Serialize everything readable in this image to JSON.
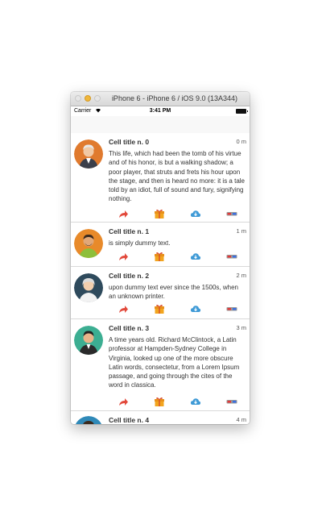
{
  "window": {
    "title": "iPhone 6 - iPhone 6 / iOS 9.0 (13A344)"
  },
  "status_bar": {
    "carrier": "Carrier",
    "time": "3:41 PM"
  },
  "colors": {
    "share": "#e2493b",
    "gift": "#f2a51f",
    "cloud": "#3f9ad6",
    "glasses_left": "#e23a3a",
    "glasses_right": "#3a6fe2"
  },
  "cells": [
    {
      "title": "Cell title n. 0",
      "time": "0 m",
      "body": "This life, which had been the tomb of his virtue and of his honor, is but a walking shadow; a poor player, that struts and frets his hour upon the stage, and then is heard no more: it is a tale told by an idiot, full of sound and fury, signifying nothing.",
      "avatar_bg": "#e07a2e"
    },
    {
      "title": "Cell title n. 1",
      "time": "1 m",
      "body": "is simply dummy text.",
      "avatar_bg": "#e88a2a"
    },
    {
      "title": "Cell title n. 2",
      "time": "2 m",
      "body": "upon dummy text ever since the 1500s, when an unknown printer.",
      "avatar_bg": "#2e4a5c"
    },
    {
      "title": "Cell title n. 3",
      "time": "3 m",
      "body": "A time  years old. Richard McClintock, a Latin professor at Hampden-Sydney College in Virginia, looked up one of the more obscure Latin words, consectetur, from a Lorem Ipsum passage, and going through the cites of the word in classica.",
      "avatar_bg": "#3cae92"
    },
    {
      "title": "Cell title n. 4",
      "time": "4 m",
      "body": "",
      "avatar_bg": "#2f89b8"
    }
  ]
}
